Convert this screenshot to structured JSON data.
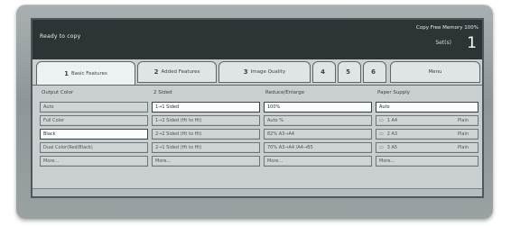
{
  "status": {
    "message": "Ready to copy",
    "memory": "Copy Free Memory 100%",
    "sets_label": "Set(s)",
    "sets_value": "1"
  },
  "tabs": [
    {
      "num": "1",
      "label": "Basic Features"
    },
    {
      "num": "2",
      "label": "Added Features"
    },
    {
      "num": "3",
      "label": "Image Quality"
    },
    {
      "num": "4",
      "label": ""
    },
    {
      "num": "5",
      "label": ""
    },
    {
      "num": "6",
      "label": ""
    },
    {
      "num": "",
      "label": "Menu"
    }
  ],
  "columns": {
    "output_color": {
      "title": "Output Color",
      "options": [
        "Auto",
        "Full Color",
        "Black",
        "Dual Color(Red/Black)",
        "More..."
      ]
    },
    "two_sided": {
      "title": "2 Sided",
      "options": [
        "1→1 Sided",
        "1→2 Sided (Ht to Ht)",
        "2→2 Sided (Ht to Ht)",
        "2→1 Sided (Ht to Ht)",
        "More..."
      ]
    },
    "reduce_enlarge": {
      "title": "Reduce/Enlarge",
      "options": [
        "100%",
        "Auto %",
        "82%   A3→A4",
        "70%   A3→A4  /A4→B5",
        "More..."
      ]
    },
    "paper_supply": {
      "title": "Paper Supply",
      "auto": "Auto",
      "trays": [
        {
          "tray": "1",
          "size": "A4",
          "media": "Plain"
        },
        {
          "tray": "2",
          "size": "A3",
          "media": "Plain"
        },
        {
          "tray": "3",
          "size": "A5",
          "media": "Plain"
        }
      ],
      "more": "More..."
    }
  }
}
